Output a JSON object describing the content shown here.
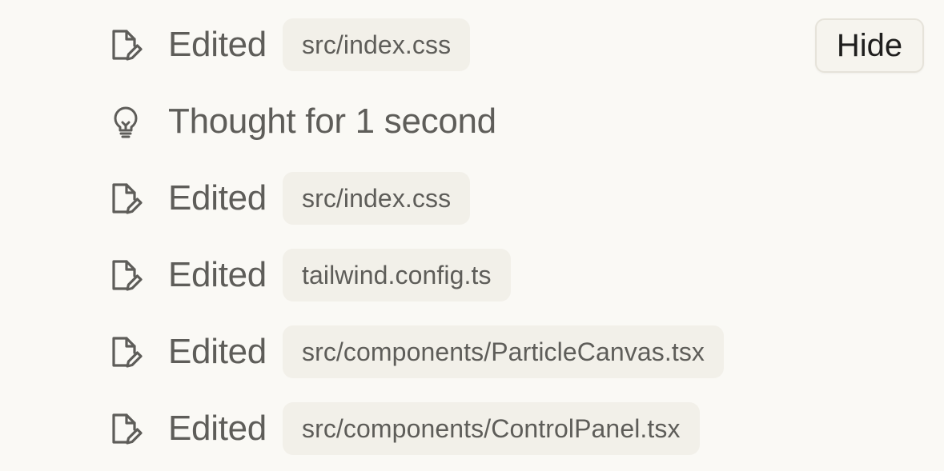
{
  "hide_button": {
    "label": "Hide"
  },
  "steps": [
    {
      "icon": "file-edit-icon",
      "label": "Edited",
      "file": "src/index.css"
    },
    {
      "icon": "lightbulb-icon",
      "label": "Thought for 1 second"
    },
    {
      "icon": "file-edit-icon",
      "label": "Edited",
      "file": "src/index.css"
    },
    {
      "icon": "file-edit-icon",
      "label": "Edited",
      "file": "tailwind.config.ts"
    },
    {
      "icon": "file-edit-icon",
      "label": "Edited",
      "file": "src/components/ParticleCanvas.tsx"
    },
    {
      "icon": "file-edit-icon",
      "label": "Edited",
      "file": "src/components/ControlPanel.tsx"
    }
  ]
}
